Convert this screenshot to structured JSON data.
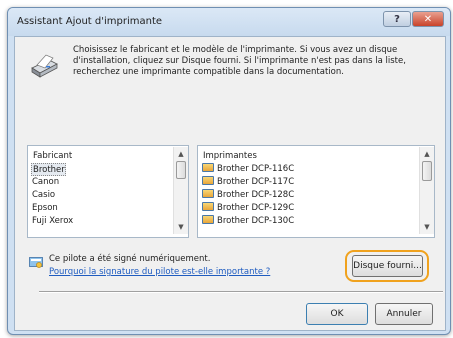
{
  "window": {
    "title": "Assistant Ajout d'imprimante",
    "help_label": "?",
    "close_label": "✕"
  },
  "intro_text": "Choisissez le fabricant et le modèle de l'imprimante. Si vous avez un disque d'installation, cliquez sur Disque fourni. Si l'imprimante n'est pas dans la liste, recherchez une imprimante compatible dans la documentation.",
  "manufacturers": {
    "header": "Fabricant",
    "items": [
      "Brother",
      "Canon",
      "Casio",
      "Epson",
      "Fuji Xerox"
    ],
    "selected": "Brother"
  },
  "printers": {
    "header": "Imprimantes",
    "items": [
      "Brother DCP-116C",
      "Brother DCP-117C",
      "Brother DCP-128C",
      "Brother DCP-129C",
      "Brother DCP-130C"
    ]
  },
  "signature": {
    "text": "Ce pilote a été signé numériquement.",
    "link": "Pourquoi la signature du pilote est-elle importante ?"
  },
  "buttons": {
    "disk": "Disque fourni...",
    "ok": "OK",
    "cancel": "Annuler"
  },
  "colors": {
    "highlight": "#f0a21e",
    "link": "#1f5cc0"
  }
}
